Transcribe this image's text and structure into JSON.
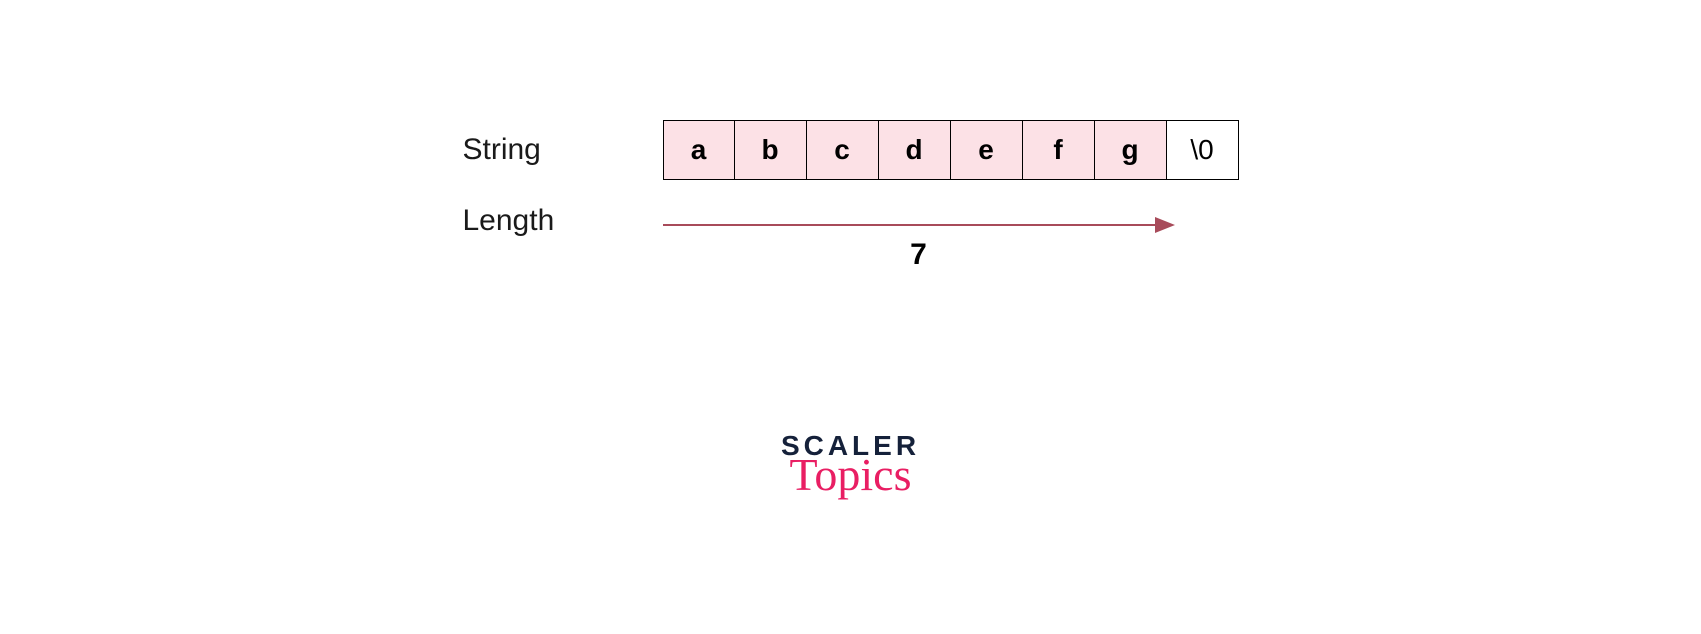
{
  "labels": {
    "string": "String",
    "length": "Length"
  },
  "cells": [
    "a",
    "b",
    "c",
    "d",
    "e",
    "f",
    "g",
    "\\0"
  ],
  "length_value": "7",
  "colors": {
    "cell_fill": "#fce1e6",
    "arrow": "#a84b5a",
    "logo_top": "#15213a",
    "logo_bottom": "#e91e63"
  },
  "logo": {
    "top": "SCALER",
    "bottom": "Topics"
  }
}
